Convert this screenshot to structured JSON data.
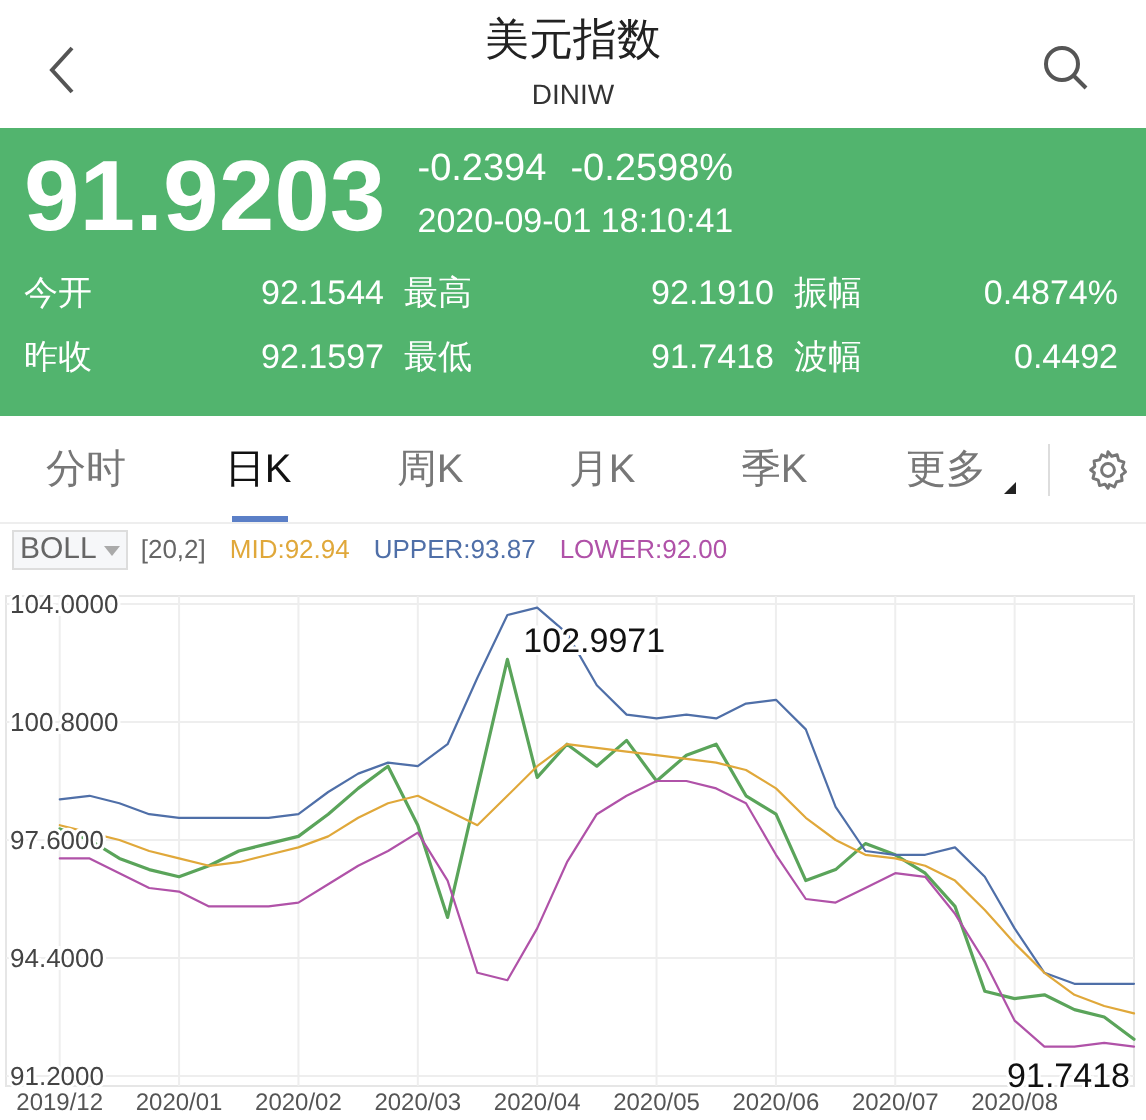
{
  "header": {
    "title": "美元指数",
    "subtitle": "DINIW"
  },
  "quote": {
    "price": "91.9203",
    "change": "-0.2394",
    "change_percent": "-0.2598%",
    "time": "2020-09-01 18:10:41"
  },
  "stats": [
    [
      {
        "label": "今开",
        "value": "92.1544"
      },
      {
        "label": "最高",
        "value": "92.1910"
      },
      {
        "label": "振幅",
        "value": "0.4874%"
      }
    ],
    [
      {
        "label": "昨收",
        "value": "92.1597"
      },
      {
        "label": "最低",
        "value": "91.7418"
      },
      {
        "label": "波幅",
        "value": "0.4492"
      }
    ]
  ],
  "tabs": [
    {
      "label": "分时",
      "selected": false,
      "kind": "tab"
    },
    {
      "label": "日K",
      "selected": true,
      "kind": "tab"
    },
    {
      "label": "周K",
      "selected": false,
      "kind": "tab"
    },
    {
      "label": "月K",
      "selected": false,
      "kind": "tab"
    },
    {
      "label": "季K",
      "selected": false,
      "kind": "tab"
    },
    {
      "label": "更多",
      "selected": false,
      "kind": "dropdown"
    }
  ],
  "indicator": {
    "name": "BOLL",
    "params": "[20,2]",
    "lines": [
      {
        "text": "MID:92.94",
        "color": "#e0a83a"
      },
      {
        "text": "UPPER:93.87",
        "color": "#4f6fa8"
      },
      {
        "text": "LOWER:92.00",
        "color": "#b052a8"
      }
    ]
  },
  "chart": {
    "chart_data": {
      "type": "line",
      "grid": true,
      "ylim": [
        91.2,
        104.0
      ],
      "yticks": [
        {
          "value": 104.0,
          "label": "104.0000"
        },
        {
          "value": 100.8,
          "label": "100.8000"
        },
        {
          "value": 97.6,
          "label": "97.6000"
        },
        {
          "value": 94.4,
          "label": "94.4000"
        },
        {
          "value": 91.2,
          "label": "91.2000"
        }
      ],
      "categories": [
        "2019/12",
        null,
        null,
        null,
        "2020/01",
        null,
        null,
        null,
        "2020/02",
        null,
        null,
        null,
        "2020/03",
        null,
        null,
        null,
        "2020/04",
        null,
        null,
        null,
        "2020/05",
        null,
        null,
        null,
        "2020/06",
        null,
        null,
        null,
        "2020/07",
        null,
        null,
        null,
        "2020/08",
        null,
        null,
        null,
        null
      ],
      "series": [
        {
          "color": "#5aa45a",
          "values": [
            97.9,
            97.6,
            97.1,
            96.8,
            96.6,
            96.9,
            97.3,
            97.5,
            97.7,
            98.3,
            99.0,
            99.6,
            98.0,
            95.5,
            99.0,
            102.5,
            99.3,
            100.2,
            99.6,
            100.3,
            99.2,
            99.9,
            100.2,
            98.8,
            98.3,
            96.5,
            96.8,
            97.5,
            97.2,
            96.7,
            95.8,
            93.5,
            93.3,
            93.4,
            93.0,
            92.8,
            92.2
          ]
        },
        {
          "color": "#4f6fa8",
          "values": [
            98.7,
            98.8,
            98.6,
            98.3,
            98.2,
            98.2,
            98.2,
            98.2,
            98.3,
            98.9,
            99.4,
            99.7,
            99.6,
            100.2,
            102.0,
            103.7,
            103.9,
            103.2,
            101.8,
            101.0,
            100.9,
            101.0,
            100.9,
            101.3,
            101.4,
            100.6,
            98.5,
            97.3,
            97.2,
            97.2,
            97.4,
            96.6,
            95.2,
            94.0,
            93.7,
            93.7,
            93.7
          ]
        },
        {
          "color": "#e0a83a",
          "values": [
            98.0,
            97.8,
            97.6,
            97.3,
            97.1,
            96.9,
            97.0,
            97.2,
            97.4,
            97.7,
            98.2,
            98.6,
            98.8,
            98.4,
            98.0,
            98.8,
            99.6,
            100.2,
            100.1,
            100.0,
            99.9,
            99.8,
            99.7,
            99.5,
            99.0,
            98.2,
            97.6,
            97.2,
            97.1,
            96.9,
            96.5,
            95.7,
            94.8,
            94.0,
            93.4,
            93.1,
            92.9
          ]
        },
        {
          "color": "#b052a8",
          "values": [
            97.1,
            97.1,
            96.7,
            96.3,
            96.2,
            95.8,
            95.8,
            95.8,
            95.9,
            96.4,
            96.9,
            97.3,
            97.8,
            96.5,
            94.0,
            93.8,
            95.2,
            97.0,
            98.3,
            98.8,
            99.2,
            99.2,
            99.0,
            98.6,
            97.2,
            96.0,
            95.9,
            96.3,
            96.7,
            96.6,
            95.6,
            94.3,
            92.7,
            92.0,
            92.0,
            92.1,
            92.0
          ]
        }
      ],
      "annotations": [
        "102.9971",
        "91.7418"
      ]
    }
  }
}
